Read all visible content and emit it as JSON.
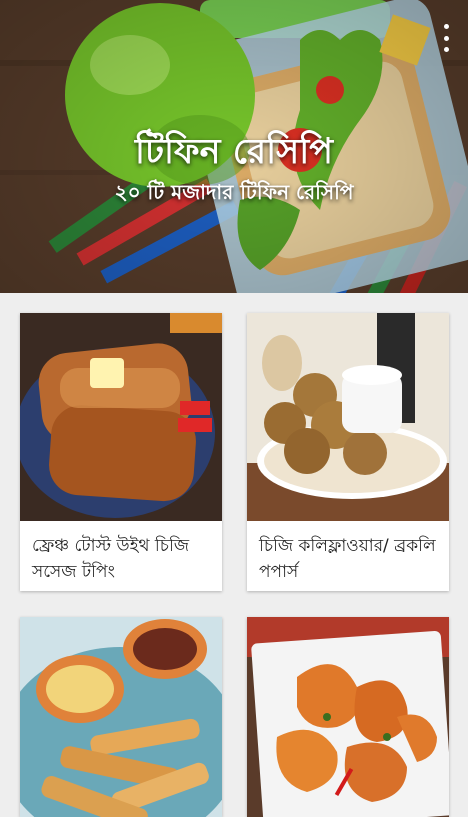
{
  "header": {
    "title": "টিফিন রেসিপি",
    "subtitle": "২০ টি মজাদার টিফিন রেসিপি",
    "menu_icon": "overflow-menu-icon"
  },
  "recipes": [
    {
      "title": "ফ্রেঞ্চ টোস্ট উইথ চিজি সসেজ টপিং",
      "image": "french-toast-image"
    },
    {
      "title": "চিজি কলিফ্লাওয়ার/ ব্রকলি পপার্স",
      "image": "cauliflower-poppers-image"
    },
    {
      "title": "",
      "image": "fish-fingers-image"
    },
    {
      "title": "",
      "image": "fried-prawns-image"
    }
  ],
  "colors": {
    "background": "#eeeeee",
    "card": "#ffffff",
    "text": "#222222",
    "header_text": "#ffffff"
  }
}
